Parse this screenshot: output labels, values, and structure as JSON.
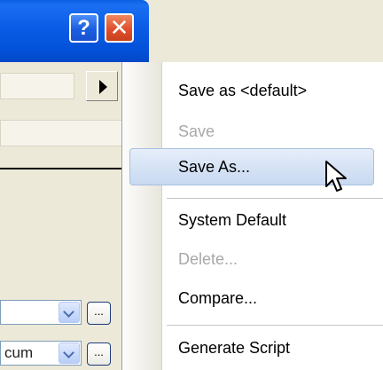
{
  "window": {
    "help_glyph": "?",
    "close_glyph": "✕"
  },
  "controls": {
    "ellipsis_label": "...",
    "combo1_value": "",
    "combo2_value": "cum"
  },
  "menu": {
    "items": [
      {
        "label": "Save as <default>",
        "enabled": true
      },
      {
        "label": "Save",
        "enabled": false
      },
      {
        "label": "Save As...",
        "enabled": true,
        "highlighted": true
      },
      {
        "label": "System Default",
        "enabled": true
      },
      {
        "label": "Delete...",
        "enabled": false
      },
      {
        "label": "Compare...",
        "enabled": true
      },
      {
        "label": "Generate Script",
        "enabled": true
      }
    ]
  },
  "colors": {
    "titlebar_blue": "#0a5ce6",
    "close_red": "#e0502c",
    "menu_highlight": "#c7d9f1",
    "disabled_text": "#a8a8a8"
  }
}
